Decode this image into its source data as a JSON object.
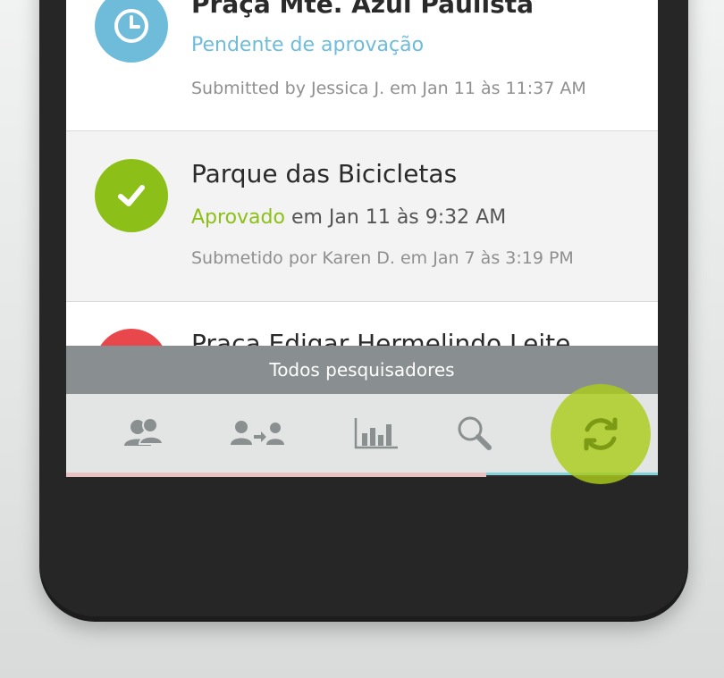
{
  "colors": {
    "pending": "#6fbcda",
    "approved": "#8cbf17",
    "rejected": "#e8474b",
    "filter_bar": "#898f91",
    "tab_bar": "#e3e5e4",
    "icon_gray": "#8a8f90",
    "highlight": "#accc1b"
  },
  "items": [
    {
      "title": "Praça Mte. Azul Paulista",
      "status": "Pendente de aprovação",
      "meta": "Submitted by Jessica J. em Jan 11 às 11:37 AM",
      "icon": "clock-icon"
    },
    {
      "title": "Parque das Bicicletas",
      "status": "Aprovado",
      "status_suffix": " em Jan 11 às 9:32 AM",
      "meta": "Submetido por Karen D. em Jan 7 às 3:19 PM",
      "icon": "check-icon"
    },
    {
      "title": "Praça Edigar Hermelindo Leite",
      "icon": "rejected-icon"
    }
  ],
  "filter_bar": {
    "label": "Todos pesquisadores"
  },
  "tabs": [
    {
      "icon": "users-icon"
    },
    {
      "icon": "user-transfer-icon"
    },
    {
      "icon": "bar-chart-icon"
    },
    {
      "icon": "search-icon"
    },
    {
      "icon": "sync-icon"
    }
  ]
}
